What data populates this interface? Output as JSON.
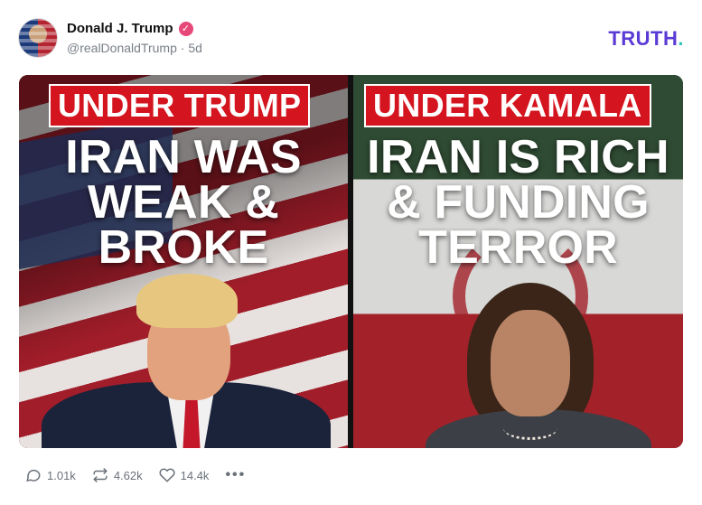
{
  "post": {
    "author": {
      "display_name": "Donald J. Trump",
      "verified": true,
      "handle": "@realDonaldTrump",
      "separator": "·",
      "age": "5d"
    },
    "brand": {
      "logo_text": "TRUTH",
      "logo_dot": "."
    },
    "media": {
      "left": {
        "tag": "UNDER TRUMP",
        "headline": [
          "IRAN WAS",
          "WEAK &",
          "BROKE"
        ]
      },
      "right": {
        "tag": "UNDER KAMALA",
        "headline": [
          "IRAN IS RICH",
          "& FUNDING",
          "TERROR"
        ]
      }
    },
    "actions": {
      "replies": "1.01k",
      "retruths": "4.62k",
      "likes": "14.4k",
      "more": "•••"
    }
  },
  "colors": {
    "brand_purple": "#5b3bd6",
    "brand_teal": "#2ec7b8",
    "tag_red": "#d4141e",
    "verified_pink": "#e6487a"
  },
  "icons": {
    "reply": "reply-icon",
    "retruth": "retruth-icon",
    "like": "heart-icon",
    "more": "more-icon",
    "verified": "verified-badge-icon"
  }
}
